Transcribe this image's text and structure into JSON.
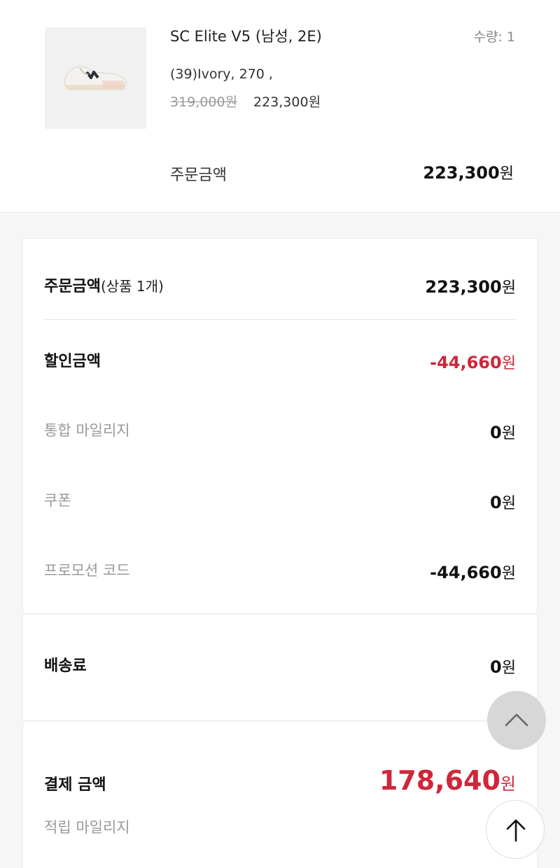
{
  "product": {
    "name": "SC Elite V5 (남성, 2E)",
    "quantity_label": "수량: 1",
    "option": "(39)Ivory, 270 ,",
    "original_price": "319,000원",
    "sale_price": "223,300원",
    "image_icon": "running-shoe-icon"
  },
  "order_total": {
    "label": "주문금액",
    "value": "223,300",
    "unit": "원"
  },
  "summary": {
    "order_amount": {
      "label": "주문금액",
      "sub_label": "(상품 1개)",
      "value": "223,300",
      "unit": "원"
    },
    "discount": {
      "label": "할인금액",
      "value": "-44,660",
      "unit": "원"
    },
    "mileage": {
      "label": "통합 마일리지",
      "value": "0",
      "unit": "원"
    },
    "coupon": {
      "label": "쿠폰",
      "value": "0",
      "unit": "원"
    },
    "promo_code": {
      "label": "프로모션 코드",
      "value": "-44,660",
      "unit": "원"
    },
    "shipping": {
      "label": "배송료",
      "value": "0",
      "unit": "원"
    },
    "payment": {
      "label": "결제 금액",
      "value": "178,640",
      "unit": "원"
    },
    "earned_mileage": {
      "label": "적립 마일리지"
    }
  },
  "colors": {
    "accent_red": "#d0263a"
  },
  "fabs": {
    "collapse_icon": "chevron-up-icon",
    "top_icon": "arrow-up-icon"
  }
}
